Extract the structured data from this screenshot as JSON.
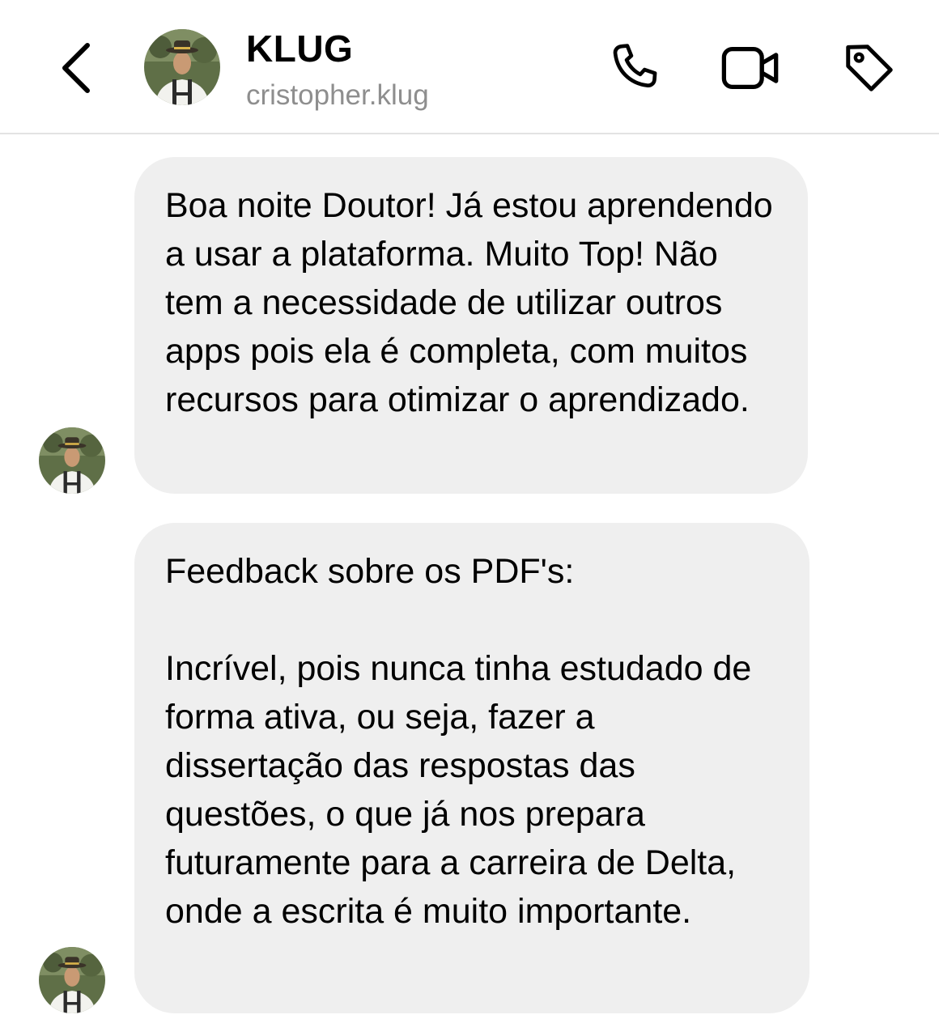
{
  "header": {
    "back_icon": "chevron-left-icon",
    "contact_name": "KLUG",
    "username": "cristopher.klug",
    "actions": {
      "call_icon": "phone-icon",
      "video_icon": "video-camera-icon",
      "tag_icon": "tag-icon"
    }
  },
  "messages": [
    {
      "text": "Boa noite Doutor! Já estou aprendendo a usar a plataforma. Muito Top! Não tem a necessidade de utilizar outros apps pois ela é completa, com muitos recursos para otimizar o aprendizado."
    },
    {
      "text": "Feedback sobre os PDF's:\n\nIncrível, pois nunca tinha estudado de forma ativa, ou seja, fazer a dissertação das respostas das questões, o que já nos prepara futuramente para a carreira de Delta, onde a escrita é muito importante."
    }
  ],
  "colors": {
    "bubble_background": "#efefef",
    "subtitle_gray": "#8e8e8e",
    "divider": "#e3e3e3"
  }
}
